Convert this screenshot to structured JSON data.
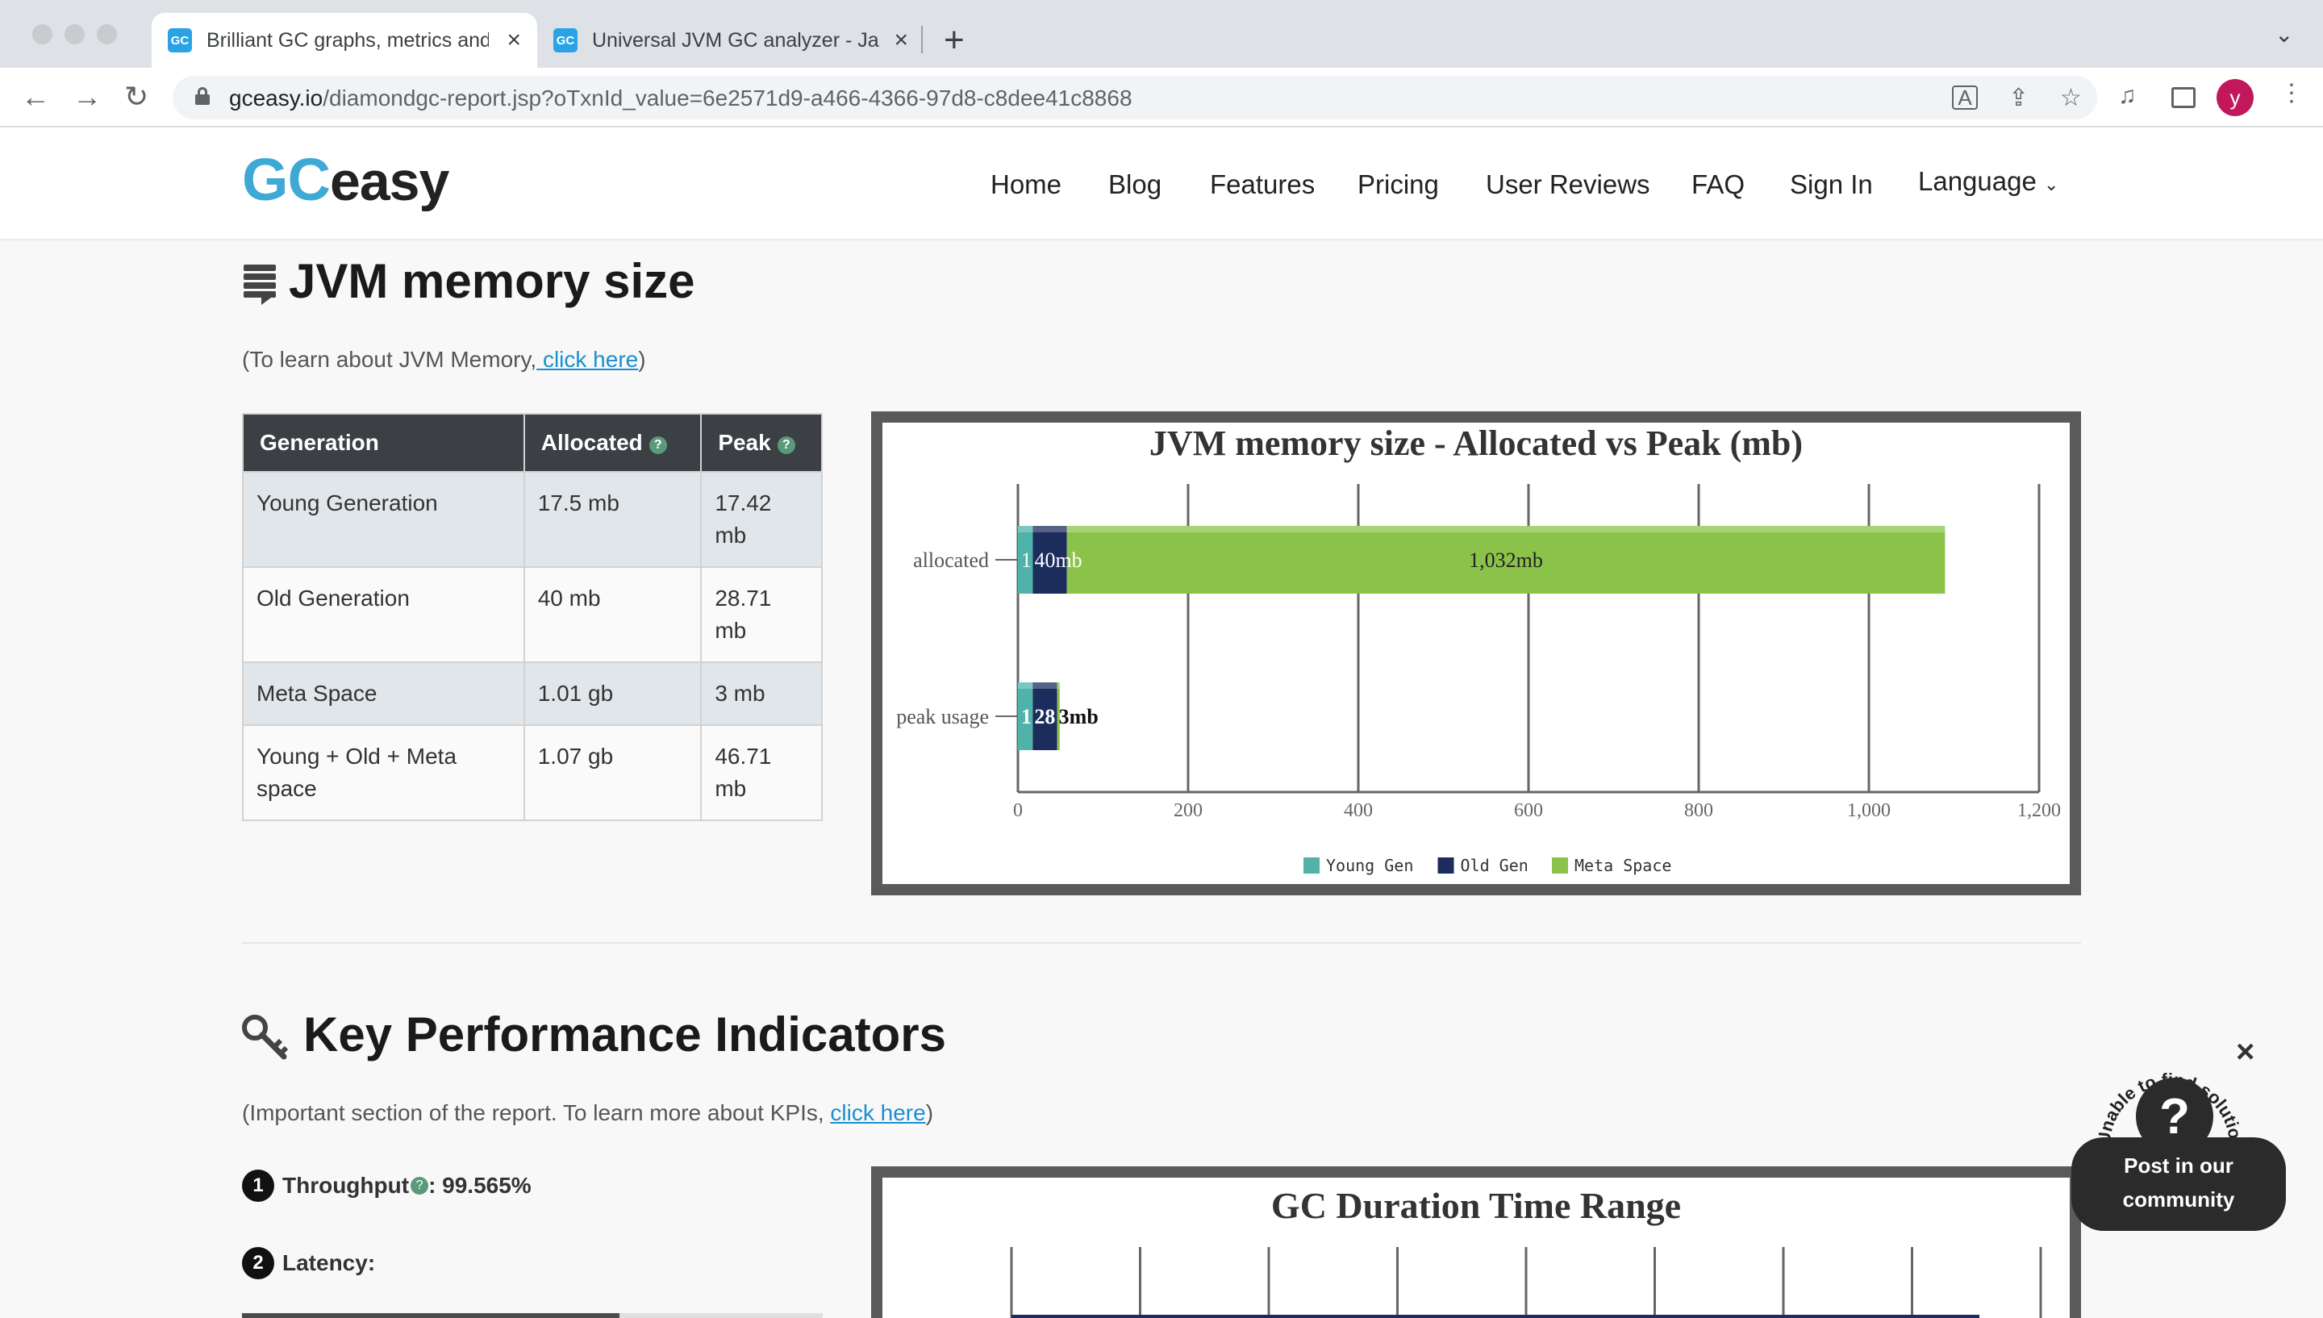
{
  "browser": {
    "tabs": [
      {
        "title": "Brilliant GC graphs, metrics and",
        "favicon": "GC",
        "active": true
      },
      {
        "title": "Universal JVM GC analyzer - Ja",
        "favicon": "GC",
        "active": false
      }
    ],
    "url_host": "gceasy.io",
    "url_path": "/diamondgc-report.jsp?oTxnId_value=6e2571d9-a466-4366-97d8-c8dee41c8868",
    "avatar_letter": "y",
    "icons": [
      "back-icon",
      "forward-icon",
      "reload-icon",
      "lock-icon",
      "translate-icon",
      "share-icon",
      "star-icon",
      "media-icon",
      "sidepanel-icon",
      "menu-icon"
    ]
  },
  "site": {
    "logo_gc": "GC",
    "logo_easy": "easy",
    "nav": [
      "Home",
      "Blog",
      "Features",
      "Pricing",
      "User Reviews",
      "FAQ",
      "Sign In",
      "Language"
    ]
  },
  "memory": {
    "title": "JVM memory size",
    "note_prefix": "(To learn about JVM Memory,",
    "note_link": " click here",
    "note_suffix": ")",
    "table": {
      "headers": [
        "Generation",
        "Allocated",
        "Peak"
      ],
      "rows": [
        {
          "generation": "Young Generation",
          "allocated": "17.5 mb",
          "peak": "17.42 mb"
        },
        {
          "generation": "Old Generation",
          "allocated": "40 mb",
          "peak": "28.71 mb"
        },
        {
          "generation": "Meta Space",
          "allocated": "1.01 gb",
          "peak": "3 mb"
        },
        {
          "generation": "Young + Old + Meta space",
          "allocated": "1.07 gb",
          "peak": "46.71 mb"
        }
      ]
    }
  },
  "kpi": {
    "title": "Key Performance Indicators",
    "note_prefix": "(Important section of the report. To learn more about KPIs, ",
    "note_link": "click here",
    "note_suffix": ")",
    "items": [
      {
        "num": "1",
        "label": "Throughput",
        "value": " : 99.565%"
      },
      {
        "num": "2",
        "label": "Latency:",
        "value": ""
      }
    ]
  },
  "widget": {
    "arc_text": "Unable to find solution",
    "button": "Post in our community",
    "question": "?",
    "close": "×"
  },
  "chart_data": [
    {
      "type": "bar",
      "orientation": "horizontal",
      "stacked": true,
      "title": "JVM memory size - Allocated vs Peak (mb)",
      "categories": [
        "allocated",
        "peak usage"
      ],
      "series": [
        {
          "name": "Young Gen",
          "color": "#4fb3a9",
          "values": [
            17.5,
            17.42
          ],
          "labels": [
            "1",
            "1"
          ]
        },
        {
          "name": "Old Gen",
          "color": "#1c2c5c",
          "values": [
            40,
            28.71
          ],
          "labels": [
            "40mb",
            "28"
          ]
        },
        {
          "name": "Meta Space",
          "color": "#8bc34a",
          "values": [
            1032,
            3
          ],
          "labels": [
            "1,032mb",
            "3mb"
          ]
        }
      ],
      "xlim": [
        0,
        1200
      ],
      "xticks": [
        "0",
        "200",
        "400",
        "600",
        "800",
        "1,000",
        "1,200"
      ],
      "legend": "bottom"
    },
    {
      "type": "bar",
      "title": "GC Duration Time Range",
      "partial": true
    }
  ]
}
